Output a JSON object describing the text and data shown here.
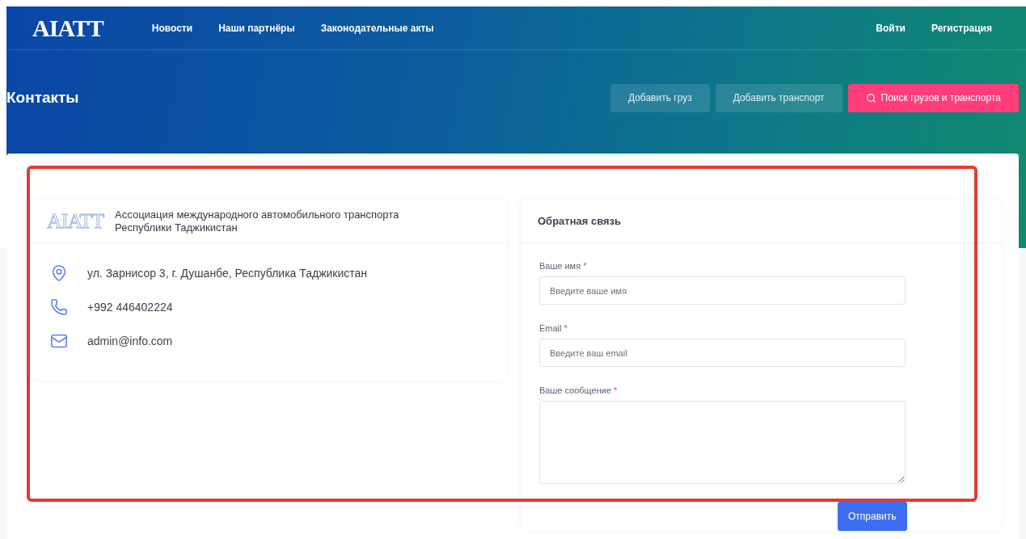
{
  "header": {
    "logo": "AIATT",
    "nav": [
      "Новости",
      "Наши партнёры",
      "Законодательные акты"
    ],
    "auth": [
      "Войти",
      "Регистрация"
    ]
  },
  "page_title": "Контакты",
  "actions": [
    {
      "label": "Добавить груз",
      "kind": "secondary"
    },
    {
      "label": "Добавить транспорт",
      "kind": "secondary"
    },
    {
      "label": "Поиск грузов и транспорта",
      "kind": "primary"
    }
  ],
  "organization": {
    "logo": "AIATT",
    "name": "Ассоциация международного автомобильного транспорта Республики Таджикистан",
    "contacts": [
      {
        "kind": "address",
        "text": "ул. Зарнисор 3, г. Душанбе, Республика Таджикистан"
      },
      {
        "kind": "phone",
        "text": "+992 446402224"
      },
      {
        "kind": "email",
        "text": "admin@info.com"
      }
    ]
  },
  "feedback": {
    "title": "Обратная связь",
    "fields": [
      {
        "kind": "input",
        "label": "Ваше имя",
        "mark": "*",
        "placeholder": "Введите ваше имя"
      },
      {
        "kind": "input",
        "label": "Email",
        "mark": "*",
        "placeholder": "Введите ваш email"
      },
      {
        "kind": "textarea",
        "label": "Ваше сообщение",
        "mark": "*"
      }
    ],
    "submit": "Отправить"
  }
}
